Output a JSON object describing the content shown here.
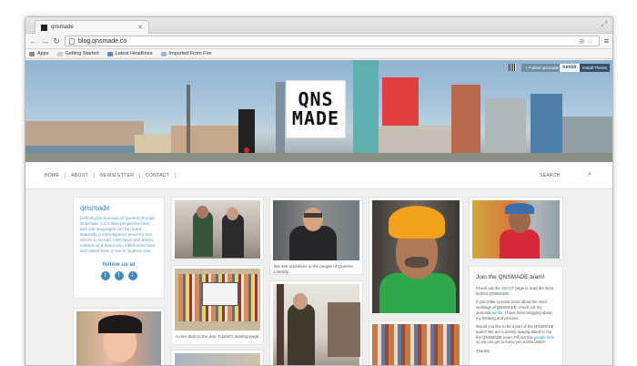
{
  "browser": {
    "tab_title": "qnsmade",
    "url": "blog.qnsmade.co",
    "bookmarks": [
      {
        "label": "Apps",
        "icon": "apps-icon",
        "color": "#8a8a8a"
      },
      {
        "label": "Getting Started",
        "icon": "page-icon",
        "color": "#cfcfcf"
      },
      {
        "label": "Latest Headlines",
        "icon": "rss-icon",
        "color": "#5f86c8"
      },
      {
        "label": "Imported From Fire",
        "icon": "folder-icon",
        "color": "#9bb6d8"
      }
    ]
  },
  "header": {
    "logo_line1": "QNS",
    "logo_line2": "MADE",
    "follow_label": "+ Follow qnsmade",
    "tumblr_label": "tumblr.",
    "install_label": "Install Theme"
  },
  "nav": {
    "items": [
      "HOME",
      "ABOUT",
      "NEWSLETTER",
      "CONTACT"
    ],
    "search_label": "SEARCH"
  },
  "sidebar": {
    "title": "qnsmade",
    "description": "Defining the borough of Queens through its people. 2.2 million people live here and 138 languages can be heard. Naturally, a serendipitous place for rich stories to be told. Interviews with artists, makers, and doers who either were born and raised here or live in Queens now.",
    "follow_label": "follow us at",
    "social": [
      "t",
      "f",
      "i"
    ]
  },
  "posts": {
    "caption_queens": "We see ourselves in the people of Queens. Literally.",
    "caption_tumblr": "A nice start to the day. Tumblr's landing page."
  },
  "join": {
    "title": "Join the QNSMADE team!",
    "p1_a": "Check out the ",
    "p1_link": "ABOUT",
    "p1_b": " page to read the story behind QNSMADE.",
    "p2_a": "If you'd like to know more about the inner workings of QNSMADE, check out my personal ",
    "p2_link": "tumblr",
    "p2_b": ". I have been blogging about my thinking and process.",
    "p3_a": "Would you like to be a part of the QNSMADE team? We are currently looking talent to rep the QNSMADE team. Fill out this ",
    "p3_link": "google form",
    "p3_b": " so we can get to know you a little better!",
    "p4": "Thanks!"
  }
}
